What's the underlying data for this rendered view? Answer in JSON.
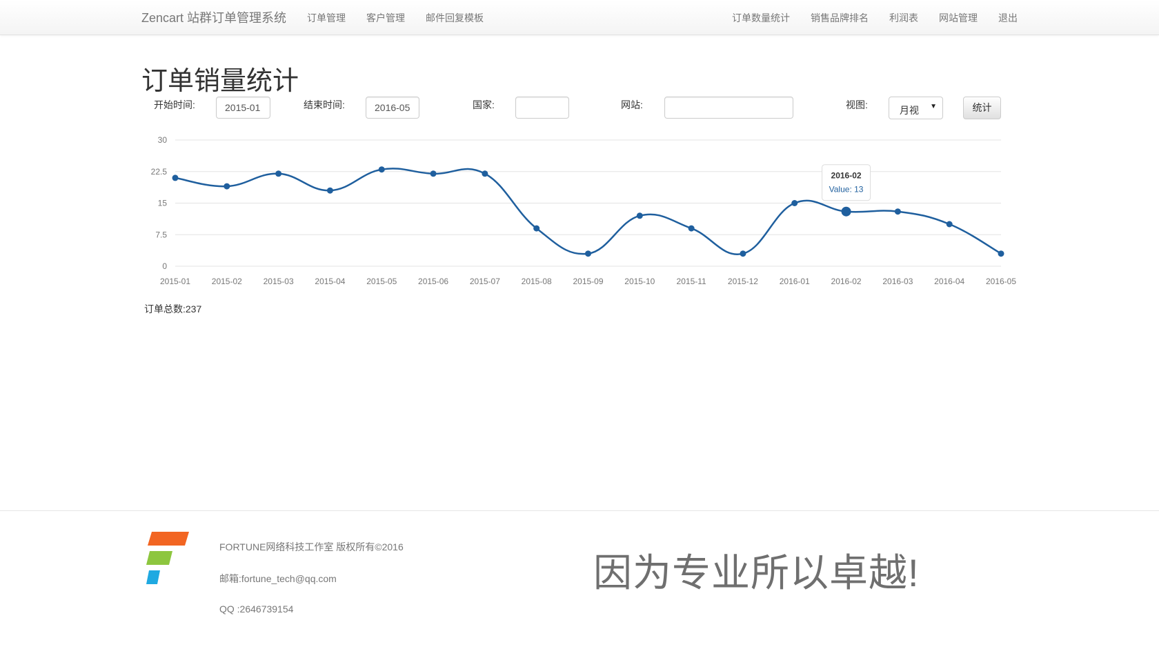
{
  "nav": {
    "brand": "Zencart 站群订单管理系统",
    "left_items": [
      "订单管理",
      "客户管理",
      "邮件回复模板"
    ],
    "right_items": [
      "订单数量统计",
      "销售品牌排名",
      "利润表",
      "网站管理",
      "退出"
    ]
  },
  "page": {
    "title": "订单销量统计"
  },
  "form": {
    "start_label": "开始时间:",
    "start_value": "2015-01",
    "end_label": "结束时间:",
    "end_value": "2016-05",
    "country_label": "国家:",
    "country_value": "",
    "site_label": "网站:",
    "site_value": "",
    "view_label": "视图:",
    "view_value": "月视",
    "submit_label": "统计"
  },
  "chart_data": {
    "type": "line",
    "x": [
      "2015-01",
      "2015-02",
      "2015-03",
      "2015-04",
      "2015-05",
      "2015-06",
      "2015-07",
      "2015-08",
      "2015-09",
      "2015-10",
      "2015-11",
      "2015-12",
      "2016-01",
      "2016-02",
      "2016-03",
      "2016-04",
      "2016-05"
    ],
    "series": [
      {
        "values": [
          21,
          19,
          22,
          18,
          23,
          22,
          22,
          9,
          3,
          12,
          9,
          3,
          15,
          13,
          13,
          10,
          3
        ]
      }
    ],
    "yticks": [
      "0",
      "7.5",
      "15",
      "22.5",
      "30"
    ],
    "ylim": [
      0,
      30
    ],
    "grid": true,
    "line_color": "#1f5f9e",
    "tooltip": {
      "title": "2016-02",
      "text": "Value: 13"
    }
  },
  "summary": {
    "total": "订单总数:237"
  },
  "footer": {
    "copyright": "FORTUNE网络科技工作室 版权所有©2016",
    "email": "邮箱:fortune_tech@qq.com",
    "qq": "QQ :2646739154",
    "slogan": "因为专业所以卓越!",
    "logo_colors": [
      "#f26522",
      "#8dc63f",
      "#1fa9e1"
    ]
  }
}
